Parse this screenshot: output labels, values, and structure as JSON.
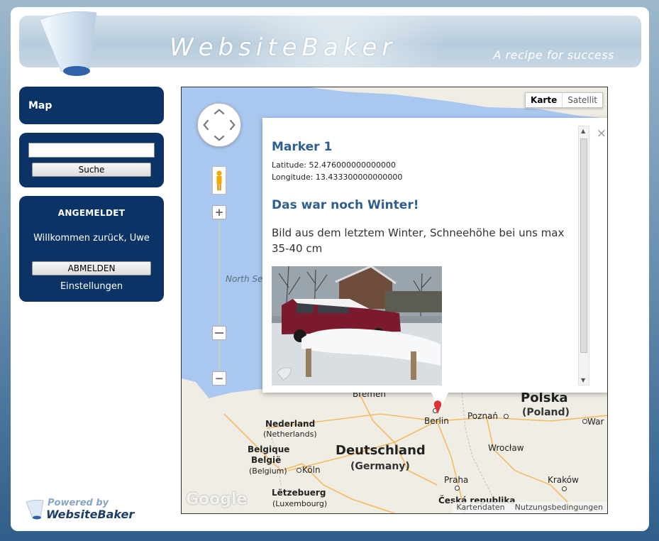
{
  "header": {
    "site_title": "WebsiteBaker",
    "tagline": "A recipe for success"
  },
  "sidebar": {
    "menu_title": "Map",
    "search": {
      "input_value": "",
      "button_label": "Suche"
    },
    "login": {
      "heading": "ANGEMELDET",
      "welcome": "Willkommen zurück, Uwe",
      "logout_label": "ABMELDEN",
      "settings_label": "Einstellungen"
    }
  },
  "powered": {
    "line1": "Powered by",
    "line2": "WebsiteBaker"
  },
  "map": {
    "type_buttons": {
      "map": "Karte",
      "satellite": "Satellit",
      "active": "map"
    },
    "zoom_in": "+",
    "zoom_out": "−",
    "labels": {
      "north_sea": "North Se",
      "bremen": "Bremen",
      "polska": "Polska",
      "poland": "(Poland)",
      "berlin": "Berlin",
      "poznan": "Poznań",
      "war": "War",
      "nederland": "Nederland",
      "netherlands": "(Netherlands)",
      "deutschland": "Deutschland",
      "germany": "(Germany)",
      "wroclaw": "Wrocław",
      "belgique": "Belgique",
      "belgie": "België",
      "belgium": "(Belgium)",
      "koln": "Köln",
      "praha": "Praha",
      "krakow": "Kraków",
      "letzeburg": "Lëtzebuerg",
      "luxembourg": "(Luxembourg)",
      "cz": "Česká republika"
    },
    "google_logo": "Google",
    "attribution": {
      "data": "Kartendaten",
      "terms": "Nutzungsbedingungen"
    },
    "info_window": {
      "title": "Marker 1",
      "latitude": "Latitude: 52.476000000000000",
      "longitude": "Longitude: 13.433300000000000",
      "heading": "Das war noch Winter!",
      "text": "Bild aus dem letztem Winter, Schneehöhe bei uns max 35-40 cm",
      "close": "×"
    }
  },
  "colors": {
    "sidebar_box": "#0b3366",
    "info_heading": "#2f5f8f",
    "water": "#a9c7ef",
    "land": "#f0ede5"
  }
}
